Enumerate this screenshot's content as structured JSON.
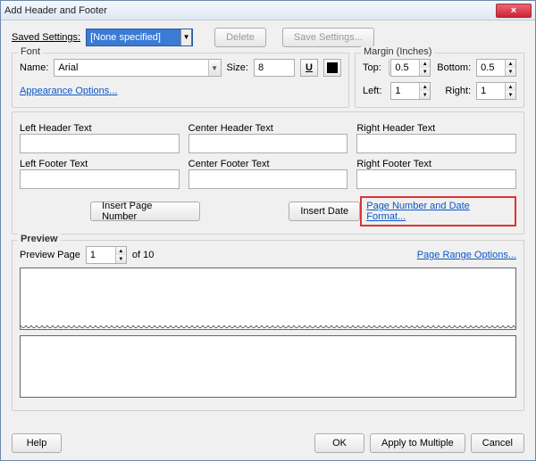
{
  "title": "Add Header and Footer",
  "saved": {
    "label": "Saved Settings:",
    "value": "[None specified]",
    "delete": "Delete",
    "save": "Save Settings..."
  },
  "font": {
    "legend": "Font",
    "name_label": "Name:",
    "name_value": "Arial",
    "size_label": "Size:",
    "size_value": "8",
    "underline_glyph": "U",
    "appearance_link": "Appearance Options..."
  },
  "margin": {
    "legend": "Margin (Inches)",
    "top_label": "Top:",
    "top_value": "0.5",
    "bottom_label": "Bottom:",
    "bottom_value": "0.5",
    "left_label": "Left:",
    "left_value": "1",
    "right_label": "Right:",
    "right_value": "1"
  },
  "hf": {
    "lh": "Left Header Text",
    "ch": "Center Header Text",
    "rh": "Right Header Text",
    "lf": "Left Footer Text",
    "cf": "Center Footer Text",
    "rf": "Right Footer Text"
  },
  "actions": {
    "insert_page": "Insert Page Number",
    "insert_date": "Insert Date",
    "format_link": "Page Number and Date Format..."
  },
  "preview": {
    "legend": "Preview",
    "page_label": "Preview Page",
    "page_value": "1",
    "of_total": "of 10",
    "range_link": "Page Range Options..."
  },
  "footer_buttons": {
    "help": "Help",
    "ok": "OK",
    "apply": "Apply to Multiple",
    "cancel": "Cancel"
  },
  "close_glyph": "×"
}
